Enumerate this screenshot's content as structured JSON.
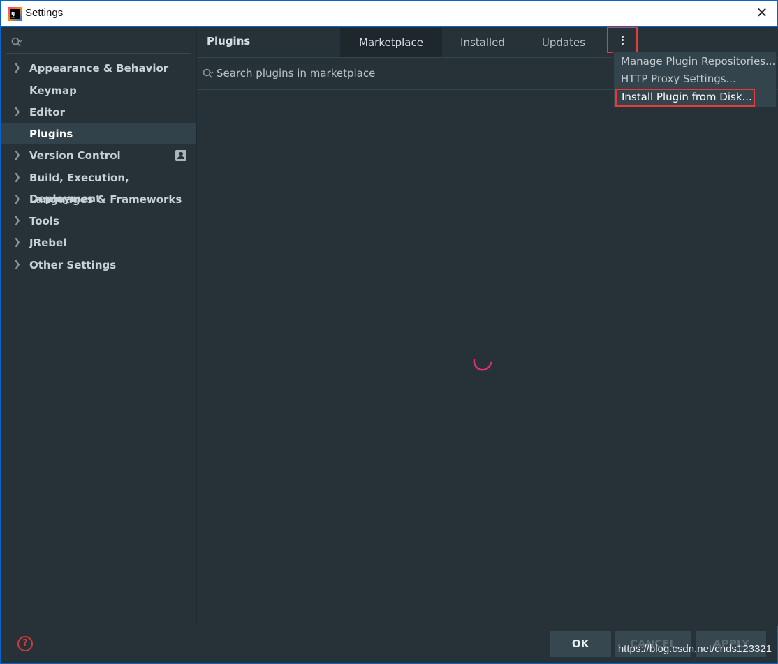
{
  "window": {
    "title": "Settings",
    "close_glyph": "✕"
  },
  "sidebar": {
    "search_placeholder": "",
    "items": [
      {
        "label": "Appearance & Behavior",
        "has_arrow": true
      },
      {
        "label": "Keymap",
        "has_arrow": false
      },
      {
        "label": "Editor",
        "has_arrow": true
      },
      {
        "label": "Plugins",
        "has_arrow": false,
        "selected": true
      },
      {
        "label": "Version Control",
        "has_arrow": true
      },
      {
        "label": "Build, Execution, Deployment",
        "has_arrow": true
      },
      {
        "label": "Languages & Frameworks",
        "has_arrow": true
      },
      {
        "label": "Tools",
        "has_arrow": true
      },
      {
        "label": "JRebel",
        "has_arrow": true
      },
      {
        "label": "Other Settings",
        "has_arrow": true
      }
    ]
  },
  "plugins": {
    "title": "Plugins",
    "tabs": [
      "Marketplace",
      "Installed",
      "Updates"
    ],
    "active_tab": "Marketplace",
    "search_text": "Search plugins in marketplace"
  },
  "menu": {
    "items": [
      "Manage Plugin Repositories...",
      "HTTP Proxy Settings...",
      "Install Plugin from Disk..."
    ],
    "highlighted": "Install Plugin from Disk..."
  },
  "footer": {
    "ok": "OK",
    "cancel": "CANCEL",
    "apply": "APPLY",
    "help_glyph": "?"
  },
  "watermark": "https://blog.csdn.net/cnds123321",
  "colors": {
    "background": "#263238",
    "accent_red": "#e23c3c",
    "spinner": "#e2306c"
  }
}
